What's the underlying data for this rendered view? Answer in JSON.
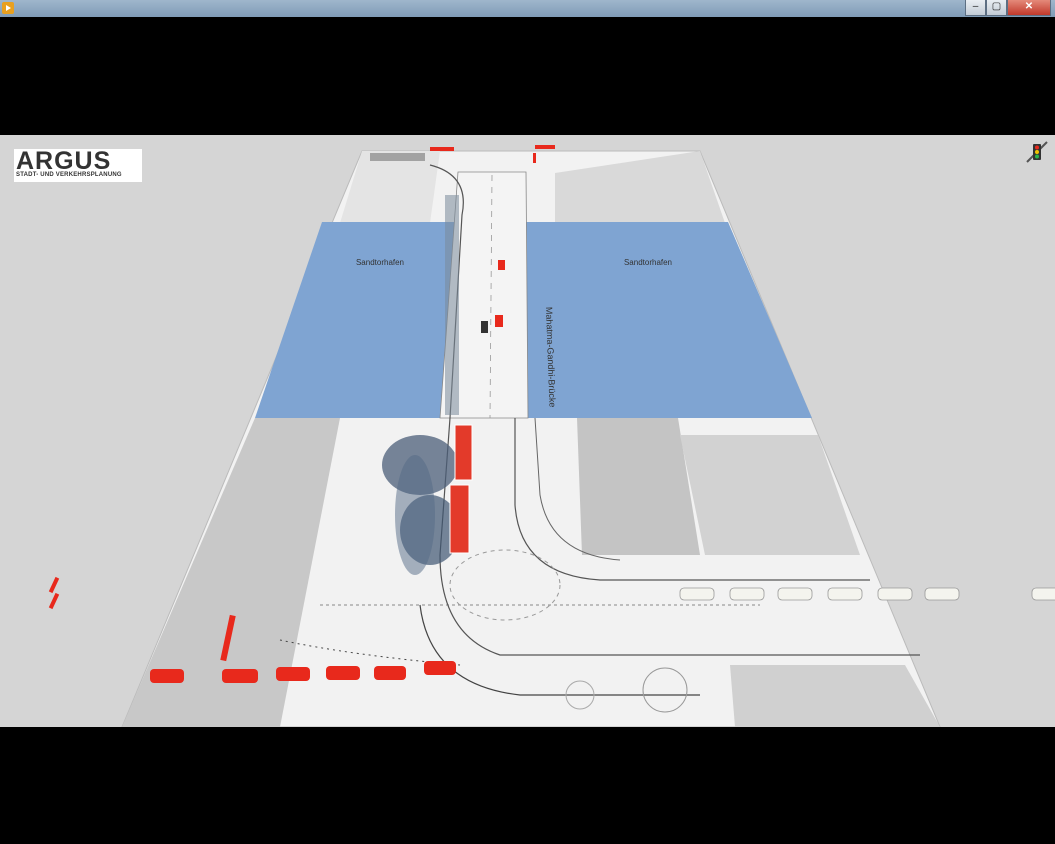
{
  "window": {
    "minimize": "–",
    "maximize": "▢",
    "close": "✕"
  },
  "logo": {
    "name": "ARGUS",
    "subtitle": "STADT- UND VERKEHRSPLANUNG"
  },
  "map": {
    "water_left_label": "Sandtorhafen",
    "water_right_label": "Sandtorhafen",
    "bridge_label": "Mahatma-Gandhi-Brücke"
  },
  "colors": {
    "water": "#7fa4d2",
    "viewport_bg": "#d5d5d5",
    "vehicle": "#e8291c",
    "bus": "#e33a2a"
  },
  "icons": {
    "toolbar": "traffic-light-icon",
    "app": "play-icon"
  }
}
